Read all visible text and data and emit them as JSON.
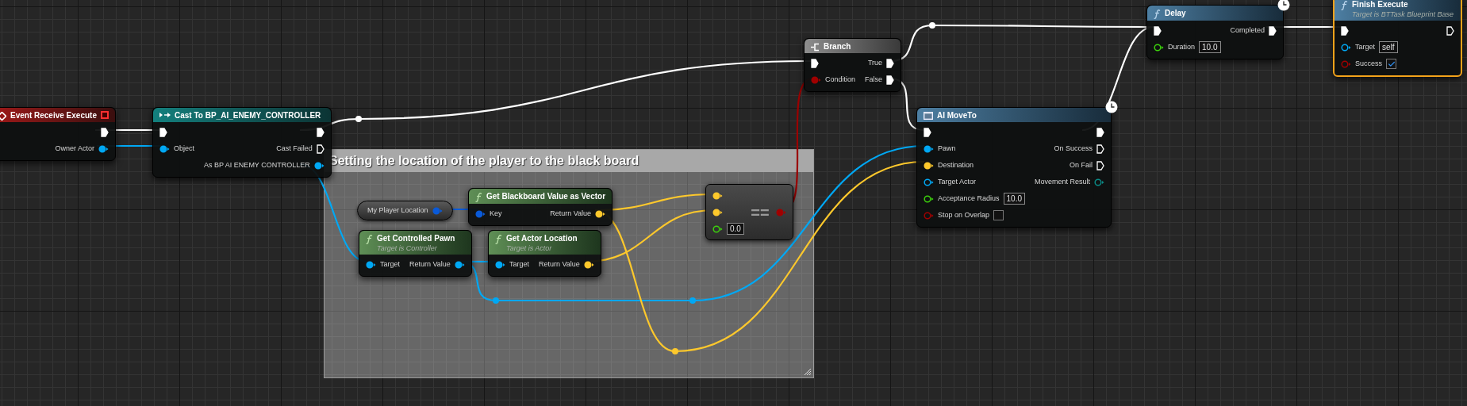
{
  "graph": {
    "comment": {
      "title": "Setting the location of the player to the black board"
    },
    "nodes": [
      {
        "kind": "event",
        "title": "Event Receive Execute",
        "selected": false,
        "latent": false,
        "outputs": [
          {
            "kind": "exec",
            "connected": true
          },
          {
            "kind": "object",
            "label": "Owner Actor",
            "connected": true
          }
        ]
      },
      {
        "kind": "cast",
        "title": "Cast To BP_AI_ENEMY_CONTROLLER",
        "selected": false,
        "latent": false,
        "inputs": [
          {
            "kind": "exec",
            "connected": true
          },
          {
            "kind": "object",
            "label": "Object",
            "connected": true
          }
        ],
        "outputs": [
          {
            "kind": "exec",
            "connected": true
          },
          {
            "kind": "exec",
            "label": "Cast Failed",
            "connected": false
          },
          {
            "kind": "object",
            "label": "As BP AI ENEMY CONTROLLER",
            "connected": true
          }
        ]
      },
      {
        "kind": "variable",
        "selected": false,
        "latent": false,
        "outputs": [
          {
            "kind": "key",
            "label": "My Player Location",
            "connected": true
          }
        ]
      },
      {
        "kind": "pure",
        "title": "Get Blackboard Value as Vector",
        "selected": false,
        "latent": false,
        "inputs": [
          {
            "kind": "key",
            "label": "Key",
            "connected": true
          }
        ],
        "outputs": [
          {
            "kind": "vector",
            "label": "Return Value",
            "connected": true
          }
        ]
      },
      {
        "kind": "pure",
        "title": "Get Controlled Pawn",
        "subtitle": "Target is Controller",
        "selected": false,
        "latent": false,
        "inputs": [
          {
            "kind": "object",
            "label": "Target",
            "connected": true
          }
        ],
        "outputs": [
          {
            "kind": "object",
            "label": "Return Value",
            "connected": true
          }
        ]
      },
      {
        "kind": "pure",
        "title": "Get Actor Location",
        "subtitle": "Target is Actor",
        "selected": false,
        "latent": false,
        "inputs": [
          {
            "kind": "object",
            "label": "Target",
            "connected": true
          }
        ],
        "outputs": [
          {
            "kind": "vector",
            "label": "Return Value",
            "connected": true
          }
        ]
      },
      {
        "kind": "compact",
        "title": "==",
        "selected": false,
        "latent": false,
        "inputs": [
          {
            "kind": "vector",
            "connected": true
          },
          {
            "kind": "vector",
            "connected": true
          },
          {
            "kind": "float",
            "connected": false,
            "value": "0.0"
          }
        ],
        "outputs": [
          {
            "kind": "bool",
            "connected": true
          }
        ]
      },
      {
        "kind": "branch",
        "title": "Branch",
        "selected": false,
        "latent": false,
        "inputs": [
          {
            "kind": "exec",
            "connected": true
          },
          {
            "kind": "bool",
            "label": "Condition",
            "connected": true
          }
        ],
        "outputs": [
          {
            "kind": "exec",
            "label": "True",
            "connected": true
          },
          {
            "kind": "exec",
            "label": "False",
            "connected": true
          }
        ]
      },
      {
        "kind": "async",
        "title": "AI MoveTo",
        "selected": false,
        "latent": true,
        "inputs": [
          {
            "kind": "exec",
            "connected": true
          },
          {
            "kind": "object",
            "label": "Pawn",
            "connected": true
          },
          {
            "kind": "vector",
            "label": "Destination",
            "connected": true
          },
          {
            "kind": "object",
            "label": "Target Actor",
            "connected": false
          },
          {
            "kind": "float",
            "label": "Acceptance Radius",
            "connected": false,
            "value": "10.0"
          },
          {
            "kind": "bool",
            "label": "Stop on Overlap",
            "connected": false,
            "checked": false
          }
        ],
        "outputs": [
          {
            "kind": "exec",
            "connected": true
          },
          {
            "kind": "exec",
            "label": "On Success",
            "connected": false
          },
          {
            "kind": "exec",
            "label": "On Fail",
            "connected": false
          },
          {
            "kind": "struct",
            "label": "Movement Result",
            "connected": false
          }
        ]
      },
      {
        "kind": "function",
        "title": "Delay",
        "selected": false,
        "latent": true,
        "inputs": [
          {
            "kind": "exec",
            "connected": true
          },
          {
            "kind": "float",
            "label": "Duration",
            "connected": false,
            "value": "10.0"
          }
        ],
        "outputs": [
          {
            "kind": "exec",
            "label": "Completed",
            "connected": true
          }
        ]
      },
      {
        "kind": "function",
        "title": "Finish Execute",
        "subtitle": "Target is BTTask Blueprint Base",
        "selected": true,
        "latent": false,
        "inputs": [
          {
            "kind": "exec",
            "connected": true
          },
          {
            "kind": "object",
            "label": "Target",
            "connected": false,
            "value": "self"
          },
          {
            "kind": "bool",
            "label": "Success",
            "connected": false,
            "checked": true
          }
        ],
        "outputs": [
          {
            "kind": "exec",
            "connected": false
          }
        ]
      }
    ]
  }
}
